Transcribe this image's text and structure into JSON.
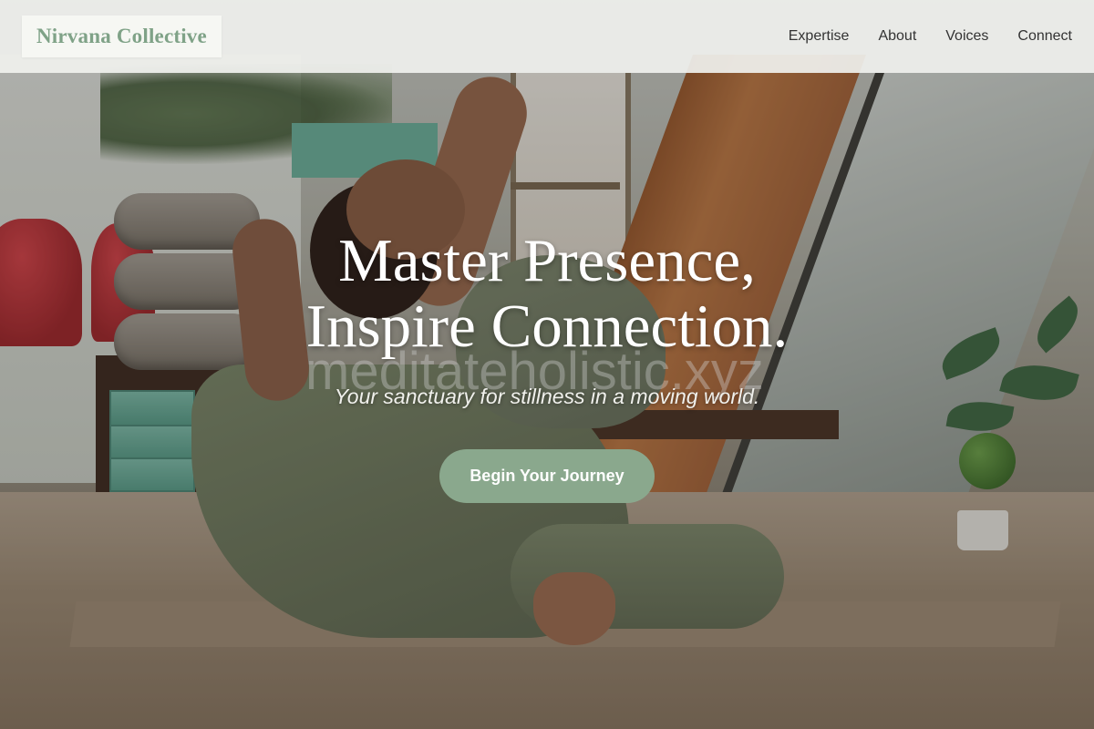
{
  "header": {
    "brand": "Nirvana Collective",
    "nav": [
      {
        "label": "Expertise"
      },
      {
        "label": "About"
      },
      {
        "label": "Voices"
      },
      {
        "label": "Connect"
      }
    ]
  },
  "hero": {
    "headline_line1": "Master Presence,",
    "headline_line2": "Inspire Connection.",
    "watermark": "meditateholistic.xyz",
    "tagline": "Your sanctuary for stillness in a moving world.",
    "cta_label": "Begin Your Journey",
    "background_image": "woman-yoga-pose-studio-photo"
  },
  "colors": {
    "brand": "#7fa287",
    "cta_background": "#8aa88d",
    "nav_text": "#333333",
    "header_background": "#f0f1ee"
  }
}
